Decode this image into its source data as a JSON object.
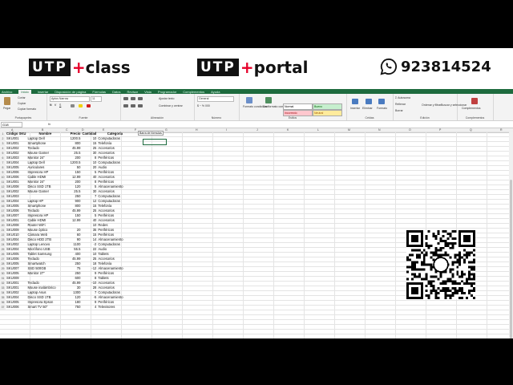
{
  "banner": {
    "logo1": {
      "box": "UTP",
      "plus": "+",
      "word": "class"
    },
    "logo2": {
      "box": "UTP",
      "plus": "+",
      "word": "portal"
    },
    "phone": "923814524"
  },
  "excel": {
    "menu": [
      "Archivo",
      "Inicio",
      "Insertar",
      "Disposición de página",
      "Fórmulas",
      "Datos",
      "Revisar",
      "Vista",
      "Programador",
      "Complementos",
      "Ayuda"
    ],
    "active_menu": "Inicio",
    "ribbon": {
      "clipboard": {
        "label": "Portapapeles",
        "paste": "Pegar",
        "cut": "Cortar",
        "copy": "Copiar",
        "format_painter": "Copiar formato"
      },
      "font": {
        "label": "Fuente",
        "font_name": "Aptos Narrow",
        "font_size": "11"
      },
      "alignment": {
        "label": "Alineación",
        "wrap": "Ajustar texto",
        "merge": "Combinar y centrar"
      },
      "number": {
        "label": "Número",
        "format": "General"
      },
      "styles": {
        "label": "Estilos",
        "cond": "Formato condicional",
        "table": "Dar formato como tabla",
        "normal": "Normal",
        "bueno": "Bueno",
        "incorrecto": "Incorrecto",
        "neutral": "Neutral"
      },
      "cells": {
        "label": "Celdas",
        "insert": "Insertar",
        "delete": "Eliminar",
        "format": "Formato"
      },
      "editing": {
        "label": "Edición",
        "autosum": "Autosuma",
        "fill": "Rellenar",
        "clear": "Borrar",
        "sort": "Ordenar y filtrar",
        "find": "Buscar y seleccionar"
      },
      "addins": {
        "label": "Complementos",
        "addins": "Complementos"
      }
    },
    "name_box": "G18",
    "fx": "fx",
    "tooltip": "Barra de fórmulas",
    "columns": [
      "A",
      "B",
      "C",
      "D",
      "E",
      "F",
      "G",
      "H",
      "I",
      "J",
      "K",
      "L",
      "M",
      "N",
      "O",
      "P",
      "Q",
      "R",
      "S",
      "T",
      "U",
      "V",
      "W"
    ],
    "headers": [
      "Código SKU",
      "Nombre",
      "Precio",
      "Cantidad",
      "Categoría"
    ],
    "rows": [
      [
        "SKU001",
        "Laptop Dell",
        "1200.5",
        "10",
        "Computadoras"
      ],
      [
        "SKU001",
        "Smartphone",
        "800",
        "15",
        "Telefonía"
      ],
      [
        "SKU002",
        "Teclado",
        "45.99",
        "25",
        "Accesorios"
      ],
      [
        "SKU002",
        "Mouse Gamer",
        "25.5",
        "30",
        "Accesorios"
      ],
      [
        "SKU003",
        "Monitor 24\"",
        "200",
        "8",
        "Periféricos"
      ],
      [
        "SKU004",
        "Laptop Dell",
        "1200.5",
        "10",
        "Computadoras"
      ],
      [
        "SKU005",
        "Auriculares",
        "50",
        "20",
        "Audio"
      ],
      [
        "SKU006",
        "Impresora HP",
        "150",
        "5",
        "Periféricos"
      ],
      [
        "SKU006",
        "Cable HDMI",
        "12.99",
        "40",
        "Accesorios"
      ],
      [
        "SKU001",
        "Monitor 24\"",
        "200",
        "8",
        "Periféricos"
      ],
      [
        "SKU008",
        "Disco SSD 1TB",
        "120",
        "5",
        "Almacenamiento"
      ],
      [
        "SKU002",
        "Mouse Gamer",
        "25.5",
        "30",
        "Accesorios"
      ],
      [
        "SKU003",
        "",
        "250",
        "7",
        "Computadoras"
      ],
      [
        "SKU004",
        "Laptop HP",
        "900",
        "12",
        "Computadoras"
      ],
      [
        "SKU005",
        "Smartphone",
        "800",
        "15",
        "Telefonía"
      ],
      [
        "SKU006",
        "Teclado",
        "45.99",
        "25",
        "Accesorios"
      ],
      [
        "SKU007",
        "Impresora HP",
        "150",
        "5",
        "Periféricos"
      ],
      [
        "SKU001",
        "Cable HDMI",
        "12.99",
        "40",
        "Accesorios"
      ],
      [
        "SKU008",
        "Router WiFi",
        "",
        "10",
        "Redes"
      ],
      [
        "SKU009",
        "Mouse óptico",
        "20",
        "35",
        "Periféricos"
      ],
      [
        "SKU010",
        "Cámara Web",
        "60",
        "15",
        "Periféricos"
      ],
      [
        "SKU004",
        "Disco HDD 2TB",
        "90",
        "14",
        "Almacenamiento"
      ],
      [
        "SKU002",
        "Laptop Lenovo",
        "1100",
        "-2",
        "Computadoras"
      ],
      [
        "SKU004",
        "Micrófono USB",
        "55.5",
        "22",
        "Audio"
      ],
      [
        "SKU005",
        "Tablet Samsung",
        "400",
        "10",
        "Tablets"
      ],
      [
        "SKU006",
        "Teclado",
        "45.99",
        "25",
        "Accesorios"
      ],
      [
        "SKU005",
        "Smartwatch",
        "250",
        "18",
        "Telefonía"
      ],
      [
        "SKU007",
        "SSD 500GB",
        "75",
        "-12",
        "Almacenamiento"
      ],
      [
        "SKU005",
        "Monitor 27\"",
        "250",
        "9",
        "Periféricos"
      ],
      [
        "SKU009",
        "",
        "600",
        "8",
        "Tablets"
      ],
      [
        "SKU001",
        "Teclado",
        "45.99",
        "-10",
        "Accesorios"
      ],
      [
        "SKU001",
        "Mouse inalámbrico",
        "30",
        "28",
        "Accesorios"
      ],
      [
        "SKU002",
        "Laptop Asus",
        "1300",
        "7",
        "Computadoras"
      ],
      [
        "SKU004",
        "Disco SSD 1TB",
        "120",
        "-5",
        "Almacenamiento"
      ],
      [
        "SKU005",
        "Impresora Epson",
        "180",
        "9",
        "Periféricos"
      ],
      [
        "SKU006",
        "Smart TV 50\"",
        "750",
        "4",
        "Televisores"
      ]
    ]
  },
  "colors": {
    "excel_green": "#1d6b3e",
    "utp_red": "#e6002a",
    "whatsapp": "#111111"
  }
}
